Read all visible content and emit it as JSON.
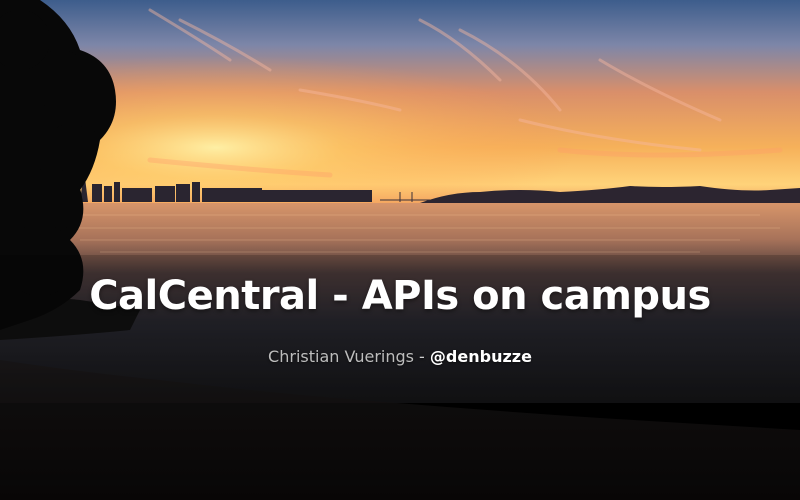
{
  "slide": {
    "title": "CalCentral - APIs on campus",
    "author": "Christian Vuerings",
    "separator": " - ",
    "handle": "@denbuzze"
  },
  "background": {
    "description_icon": "sunset-bay-photo",
    "colors": {
      "sky_top": "#4a6b9a",
      "sky_glow": "#f2a54a",
      "horizon": "#ffcf70",
      "water": "#2a2a30",
      "foreground": "#0e0c0c"
    }
  }
}
